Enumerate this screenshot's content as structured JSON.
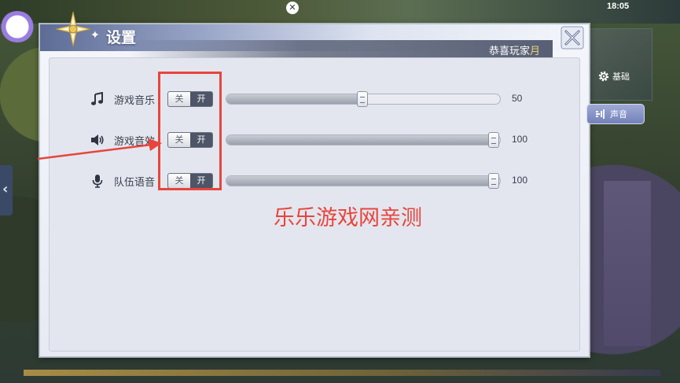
{
  "status": {
    "clock": "18:05"
  },
  "window": {
    "title": "设置",
    "greeting_prefix": "恭喜玩家",
    "greeting_name": "月"
  },
  "settings": [
    {
      "label": "游戏音乐",
      "icon": "music-note-icon",
      "toggle_off": "关",
      "toggle_on": "开",
      "value": 50,
      "value_label": "50"
    },
    {
      "label": "游戏音效",
      "icon": "speaker-icon",
      "toggle_off": "关",
      "toggle_on": "开",
      "value": 100,
      "value_label": "100"
    },
    {
      "label": "队伍语音",
      "icon": "microphone-icon",
      "toggle_off": "关",
      "toggle_on": "开",
      "value": 100,
      "value_label": "100"
    }
  ],
  "tabs": {
    "basic": "基础",
    "sound": "声音",
    "selected": "sound"
  },
  "annotation": {
    "watermark": "乐乐游戏网亲测",
    "color": "#e8453c"
  },
  "colors": {
    "panel_bg": "#e3e6ee",
    "title_bar": "#5d6c96",
    "toggle_dark": "#4e5566",
    "selected_tab": "#7381b8"
  }
}
